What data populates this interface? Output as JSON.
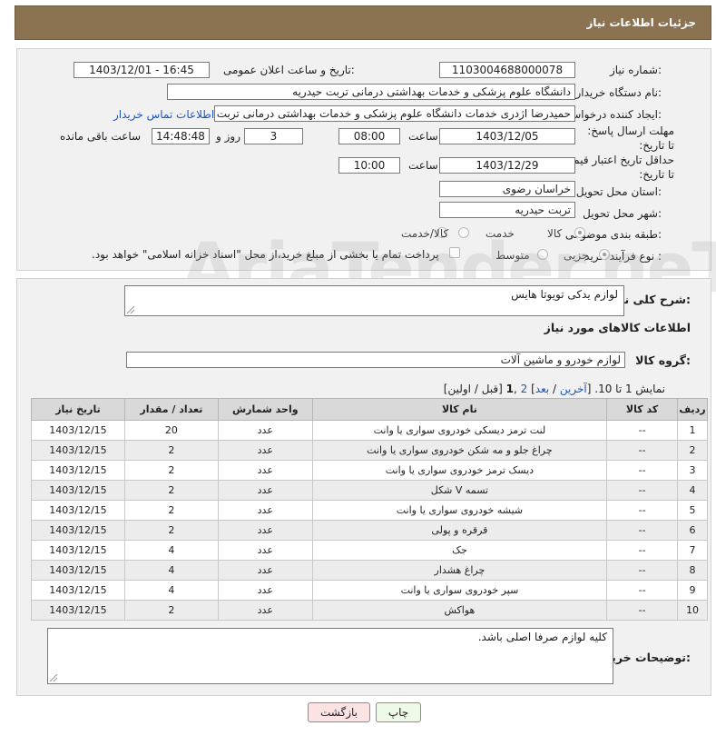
{
  "header": {
    "title": "جزئیات اطلاعات نیاز"
  },
  "form": {
    "need_number_label": "شماره نیاز:",
    "need_number": "1103004688000078",
    "announce_label": "تاریخ و ساعت اعلان عمومی:",
    "announce_value": "1403/12/01 - 16:45",
    "buyer_org_label": "نام دستگاه خریدار:",
    "buyer_org": "دانشگاه علوم پزشکی و خدمات بهداشتی درمانی تربت حیدریه",
    "requester_label": "ایجاد کننده درخواست:",
    "requester": "حمیدرضا اژدری خدمات دانشگاه علوم پزشکی و خدمات بهداشتی درمانی تربت حیدریه",
    "contact_link": "اطلاعات تماس خریدار",
    "deadline_label": "مهلت ارسال پاسخ: تا تاریخ:",
    "deadline_date": "1403/12/05",
    "time_word": "ساعت",
    "deadline_time": "08:00",
    "days_value": "3",
    "days_word": "روز و",
    "remaining_time": "14:48:48",
    "remaining_word": "ساعت باقی مانده",
    "validity_label": "حداقل تاریخ اعتبار قیمت: تا تاریخ:",
    "validity_date": "1403/12/29",
    "validity_time": "10:00",
    "province_label": "استان محل تحویل:",
    "province": "خراسان رضوی",
    "city_label": "شهر محل تحویل:",
    "city": "تربت حیدریه",
    "category_label": "طبقه بندی موضوعی:",
    "category_options": [
      "کالا",
      "خدمت",
      "کالا/خدمت"
    ],
    "process_label": "نوع فرآیند خرید :",
    "process_options": [
      "جزیی",
      "متوسط"
    ],
    "payment_note": "پرداخت تمام یا بخشی از مبلغ خرید،از محل \"اسناد خزانه اسلامی\" خواهد بود."
  },
  "summary": {
    "label": "شرح کلی نیاز:",
    "value": "لوازم یدکی تویوتا هایس",
    "goods_info_title": "اطلاعات کالاهای مورد نیاز",
    "group_label": "گروه کالا:",
    "group_value": "لوازم خودرو و ماشین آلات"
  },
  "pager": {
    "text_prefix": "نمایش 1 تا 10. [",
    "last": "آخرین",
    "sep1": " / ",
    "next": "بعد",
    "sep2": "] ",
    "page2": "2",
    "comma": " ,",
    "page1": "1",
    "text_suffix": " [قبل / اولین]"
  },
  "table": {
    "headers": [
      "ردیف",
      "کد کالا",
      "نام کالا",
      "واحد شمارش",
      "تعداد / مقدار",
      "تاریخ نیاز"
    ],
    "rows": [
      [
        "1",
        "--",
        "لنت ترمز دیسکی خودروی سواری یا وانت",
        "عدد",
        "20",
        "1403/12/15"
      ],
      [
        "2",
        "--",
        "چراغ جلو و مه شکن خودروی سواری یا وانت",
        "عدد",
        "2",
        "1403/12/15"
      ],
      [
        "3",
        "--",
        "دیسک ترمز خودروی سواری یا وانت",
        "عدد",
        "2",
        "1403/12/15"
      ],
      [
        "4",
        "--",
        "تسمه V شکل",
        "عدد",
        "2",
        "1403/12/15"
      ],
      [
        "5",
        "--",
        "شیشه خودروی سواری یا وانت",
        "عدد",
        "2",
        "1403/12/15"
      ],
      [
        "6",
        "--",
        "قرقره و پولی",
        "عدد",
        "2",
        "1403/12/15"
      ],
      [
        "7",
        "--",
        "جک",
        "عدد",
        "4",
        "1403/12/15"
      ],
      [
        "8",
        "--",
        "چراغ هشدار",
        "عدد",
        "4",
        "1403/12/15"
      ],
      [
        "9",
        "--",
        "سپر خودروی سواری یا وانت",
        "عدد",
        "4",
        "1403/12/15"
      ],
      [
        "10",
        "--",
        "هواکش",
        "عدد",
        "2",
        "1403/12/15"
      ]
    ]
  },
  "notes": {
    "label": "توضیحات خریدار:",
    "value": "کلیه لوازم صرفا اصلی باشد."
  },
  "buttons": {
    "print": "چاپ",
    "back": "بازگشت"
  },
  "watermark": "AriaTender.neT"
}
